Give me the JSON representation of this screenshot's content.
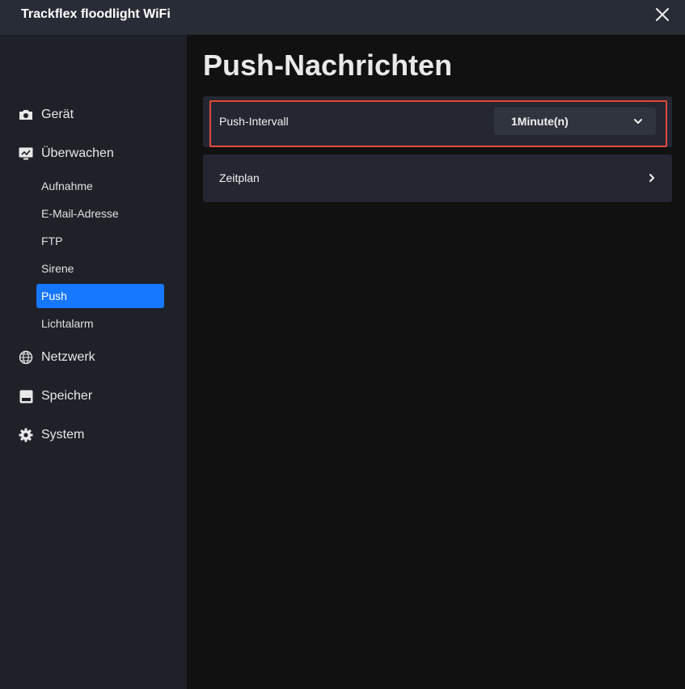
{
  "window": {
    "title": "Trackflex floodlight WiFi"
  },
  "sidebar": {
    "sections": [
      {
        "label": "Gerät",
        "icon": "camera-icon"
      },
      {
        "label": "Überwachen",
        "icon": "monitor-icon"
      },
      {
        "label": "Netzwerk",
        "icon": "globe-icon"
      },
      {
        "label": "Speicher",
        "icon": "storage-icon"
      },
      {
        "label": "System",
        "icon": "gear-icon"
      }
    ],
    "monitor_items": [
      {
        "label": "Aufnahme"
      },
      {
        "label": "E-Mail-Adresse"
      },
      {
        "label": "FTP"
      },
      {
        "label": "Sirene"
      },
      {
        "label": "Push",
        "active": true
      },
      {
        "label": "Lichtalarm"
      }
    ]
  },
  "main": {
    "title": "Push-Nachrichten",
    "push_interval": {
      "label": "Push-Intervall",
      "value": "1Minute(n)"
    },
    "schedule": {
      "label": "Zeitplan"
    }
  },
  "colors": {
    "accent": "#1677ff",
    "highlight": "#e2493b",
    "sidebar_bg": "#1f2129",
    "titlebar_bg": "#282c36"
  }
}
